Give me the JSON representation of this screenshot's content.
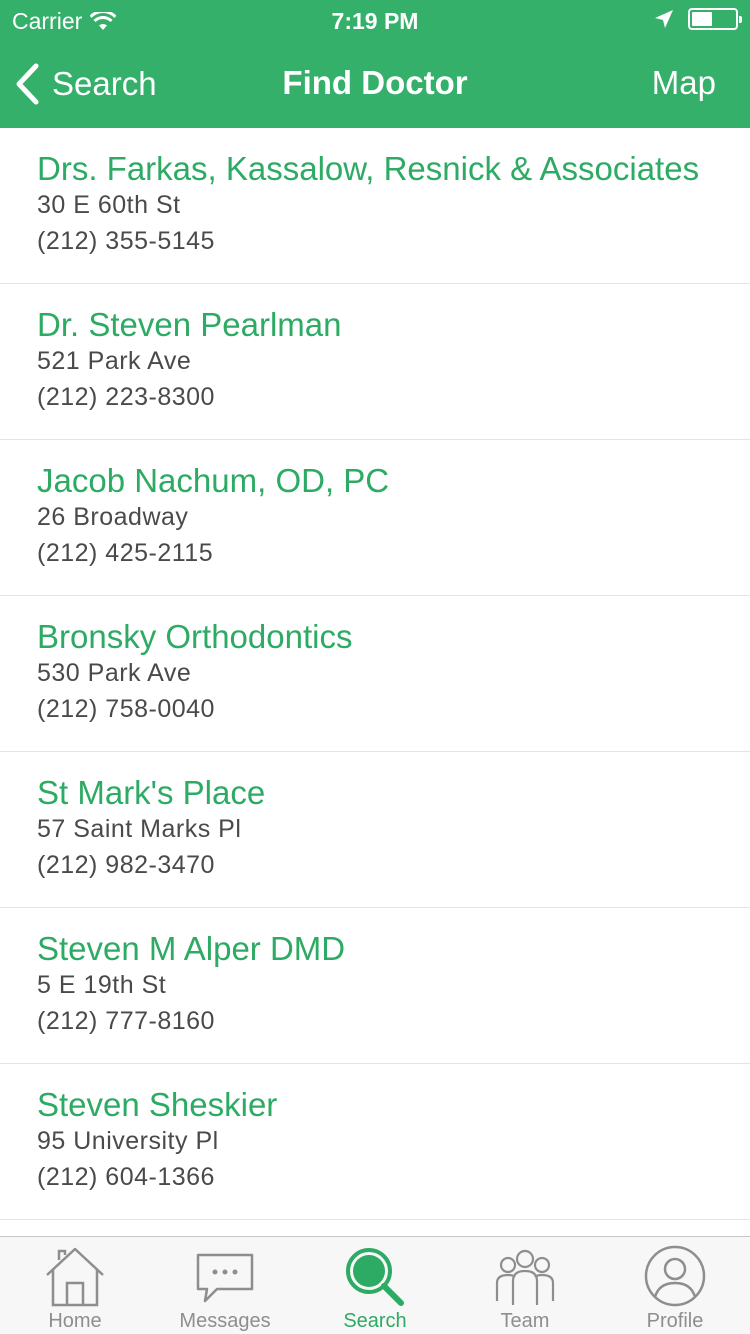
{
  "status_bar": {
    "carrier": "Carrier",
    "time": "7:19 PM"
  },
  "nav": {
    "back_label": "Search",
    "title": "Find Doctor",
    "map_label": "Map"
  },
  "doctors": [
    {
      "name": "Drs. Farkas, Kassalow, Resnick & Associates",
      "address": "30 E 60th St",
      "phone": "(212) 355-5145"
    },
    {
      "name": "Dr. Steven Pearlman",
      "address": "521 Park Ave",
      "phone": "(212) 223-8300"
    },
    {
      "name": "Jacob Nachum, OD, PC",
      "address": "26 Broadway",
      "phone": "(212) 425-2115"
    },
    {
      "name": "Bronsky Orthodontics",
      "address": "530 Park Ave",
      "phone": "(212) 758-0040"
    },
    {
      "name": "St Mark's Place",
      "address": "57 Saint Marks Pl",
      "phone": "(212) 982-3470"
    },
    {
      "name": "Steven M Alper DMD",
      "address": "5 E 19th St",
      "phone": "(212) 777-8160"
    },
    {
      "name": "Steven Sheskier",
      "address": "95 University Pl",
      "phone": "(212) 604-1366"
    }
  ],
  "tabs": [
    {
      "label": "Home",
      "icon": "home-icon",
      "active": false
    },
    {
      "label": "Messages",
      "icon": "messages-icon",
      "active": false
    },
    {
      "label": "Search",
      "icon": "search-icon",
      "active": true
    },
    {
      "label": "Team",
      "icon": "team-icon",
      "active": false
    },
    {
      "label": "Profile",
      "icon": "profile-icon",
      "active": false
    }
  ],
  "colors": {
    "brand_green": "#35b06b",
    "link_green": "#2daa63",
    "tab_inactive": "#8e8e8e"
  }
}
